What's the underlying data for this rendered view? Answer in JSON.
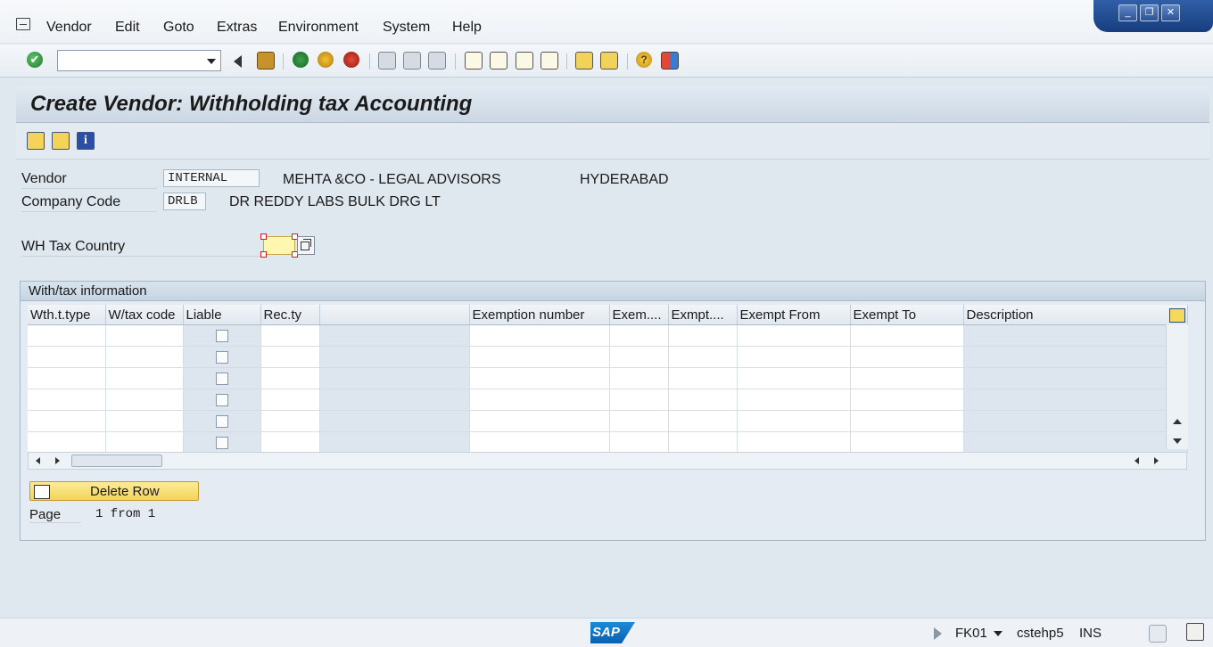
{
  "menubar": {
    "items": [
      "Vendor",
      "Edit",
      "Goto",
      "Extras",
      "Environment",
      "System",
      "Help"
    ]
  },
  "title": "Create Vendor: Withholding tax Accounting",
  "header": {
    "vendor_label": "Vendor",
    "vendor_value": "INTERNAL",
    "vendor_name": "MEHTA &CO - LEGAL ADVISORS",
    "vendor_city": "HYDERABAD",
    "company_label": "Company Code",
    "company_value": "DRLB",
    "company_name": "DR REDDY LABS BULK DRG LT",
    "wh_country_label": "WH Tax Country",
    "wh_country_value": ""
  },
  "group": {
    "title": "With/tax information",
    "columns": [
      "Wth.t.type",
      "W/tax code",
      "Liable",
      "Rec.ty",
      "",
      "Exemption number",
      "Exem....",
      "Exmpt....",
      "Exempt From",
      "Exempt To",
      "Description"
    ],
    "row_count": 6,
    "delete_row_label": "Delete Row",
    "page_label": "Page",
    "page_value": "1 from 1"
  },
  "status": {
    "logo": "SAP",
    "transaction": "FK01",
    "server": "cstehp5",
    "mode": "INS"
  },
  "icons": {
    "enter": "check-icon",
    "save": "save-icon",
    "back": "back-icon",
    "exit": "exit-icon",
    "cancel": "cancel-icon",
    "help": "help-icon"
  }
}
